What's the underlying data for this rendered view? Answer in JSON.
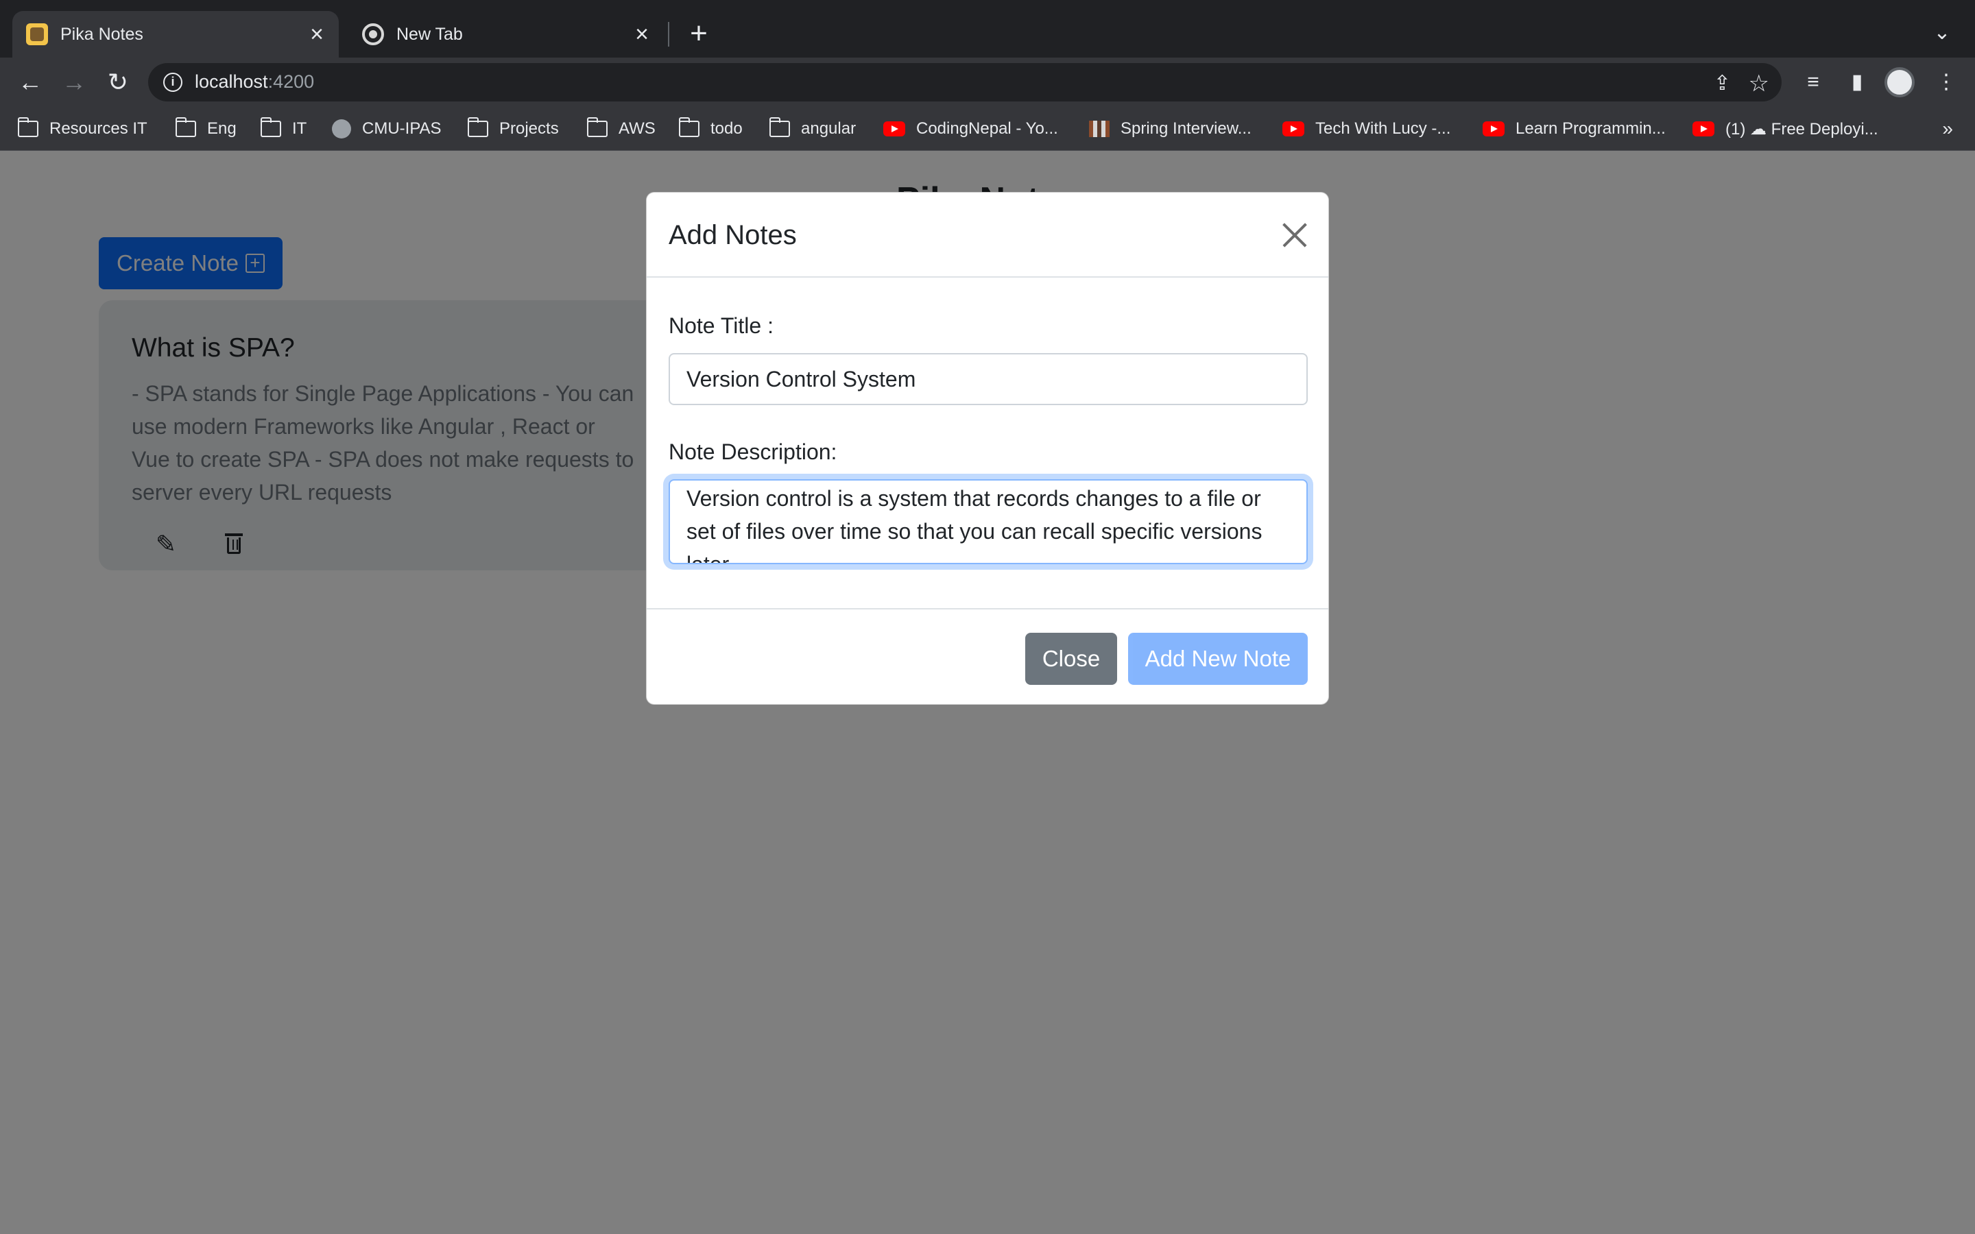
{
  "browser": {
    "tabs": [
      {
        "title": "Pika Notes",
        "favicon": "pika-favicon",
        "active": true
      },
      {
        "title": "New Tab",
        "favicon": "chrome-favicon",
        "active": false
      }
    ],
    "url_host": "localhost",
    "url_port": ":4200",
    "bookmarks": [
      {
        "label": "Resources IT",
        "icon": "folder-icon"
      },
      {
        "label": "Eng",
        "icon": "folder-icon"
      },
      {
        "label": "IT",
        "icon": "folder-icon"
      },
      {
        "label": "CMU-IPAS",
        "icon": "site-icon"
      },
      {
        "label": "Projects",
        "icon": "folder-icon"
      },
      {
        "label": "AWS",
        "icon": "folder-icon"
      },
      {
        "label": "todo",
        "icon": "folder-icon"
      },
      {
        "label": "angular",
        "icon": "folder-icon"
      },
      {
        "label": "CodingNepal - Yo...",
        "icon": "youtube-icon"
      },
      {
        "label": "Spring Interview...",
        "icon": "site-icon"
      },
      {
        "label": "Tech With Lucy -...",
        "icon": "youtube-icon"
      },
      {
        "label": "Learn Programmin...",
        "icon": "youtube-icon"
      },
      {
        "label": "(1) ☁ Free Deployi...",
        "icon": "youtube-icon"
      }
    ],
    "bookmarks_overflow": "»"
  },
  "app": {
    "title": "Pika Notes",
    "create_button": "Create Note",
    "notes": [
      {
        "title": "What is SPA?",
        "description": "- SPA stands for Single Page Applications - You can use modern Frameworks like Angular , React or Vue to create SPA - SPA does not make requests to server every URL requests"
      }
    ]
  },
  "modal": {
    "title": "Add Notes",
    "title_label": "Note Title :",
    "title_value": "Version Control System",
    "description_label": "Note Description:",
    "description_value": "Version control is a system that records changes to a file or set of files over time so that you can recall specific versions later",
    "close_button": "Close",
    "add_button": "Add New Note"
  },
  "colors": {
    "primary": "#0d6efd",
    "secondary": "#6c757d",
    "chrome_dark": "#202124",
    "chrome_toolbar": "#35363a"
  }
}
